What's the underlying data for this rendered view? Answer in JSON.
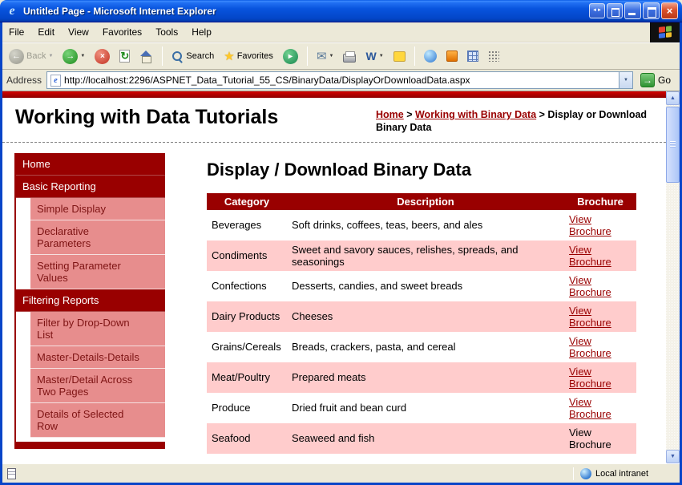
{
  "window": {
    "title": "Untitled Page - Microsoft Internet Explorer",
    "status_right": "Local intranet"
  },
  "menu": {
    "items": [
      "File",
      "Edit",
      "View",
      "Favorites",
      "Tools",
      "Help"
    ]
  },
  "toolbar": {
    "back_label": "Back",
    "search_label": "Search",
    "favorites_label": "Favorites",
    "go_label": "Go"
  },
  "address": {
    "label": "Address",
    "url": "http://localhost:2296/ASPNET_Data_Tutorial_55_CS/BinaryData/DisplayOrDownloadData.aspx"
  },
  "icons": {
    "ie_logo": "e",
    "back_arrow": "←",
    "forward_arrow": "→",
    "stop_x": "×",
    "media_play": "▸",
    "close_x": "×",
    "dropdown": "▼",
    "star": "★",
    "mail": "✉",
    "word_w": "W",
    "go_arrow": "→",
    "scroll_up": "▲",
    "scroll_down": "▼",
    "extra_arrows": "◄►"
  },
  "colors": {
    "accent_maroon": "#990000",
    "sidebar_item_pink": "#E78D8D",
    "table_alt_pink": "#FFCCCC",
    "link_maroon": "#990000",
    "titlebar_blue": "#0854DE"
  },
  "page": {
    "site_title": "Working with Data Tutorials",
    "breadcrumb_separator": ">",
    "breadcrumb": [
      {
        "label": "Home",
        "link": true
      },
      {
        "label": "Working with Binary Data",
        "link": true
      },
      {
        "label": "Display or Download Binary Data",
        "link": false
      }
    ],
    "heading": "Display / Download Binary Data",
    "sidebar": [
      {
        "label": "Home",
        "type": "header"
      },
      {
        "label": "Basic Reporting",
        "type": "header"
      },
      {
        "label": "Simple Display",
        "type": "item"
      },
      {
        "label": "Declarative Parameters",
        "type": "item"
      },
      {
        "label": "Setting Parameter Values",
        "type": "item"
      },
      {
        "label": "Filtering Reports",
        "type": "header"
      },
      {
        "label": "Filter by Drop-Down List",
        "type": "item"
      },
      {
        "label": "Master-Details-Details",
        "type": "item"
      },
      {
        "label": "Master/Detail Across Two Pages",
        "type": "item"
      },
      {
        "label": "Details of Selected Row",
        "type": "item"
      }
    ],
    "table": {
      "headers": [
        "Category",
        "Description",
        "Brochure"
      ],
      "rows": [
        {
          "category": "Beverages",
          "description": "Soft drinks, coffees, teas, beers, and ales",
          "brochure": "View Brochure",
          "brochure_link": true
        },
        {
          "category": "Condiments",
          "description": "Sweet and savory sauces, relishes, spreads, and seasonings",
          "brochure": "View Brochure",
          "brochure_link": true
        },
        {
          "category": "Confections",
          "description": "Desserts, candies, and sweet breads",
          "brochure": "View Brochure",
          "brochure_link": true
        },
        {
          "category": "Dairy Products",
          "description": "Cheeses",
          "brochure": "View Brochure",
          "brochure_link": true
        },
        {
          "category": "Grains/Cereals",
          "description": "Breads, crackers, pasta, and cereal",
          "brochure": "View Brochure",
          "brochure_link": true
        },
        {
          "category": "Meat/Poultry",
          "description": "Prepared meats",
          "brochure": "View Brochure",
          "brochure_link": true
        },
        {
          "category": "Produce",
          "description": "Dried fruit and bean curd",
          "brochure": "View Brochure",
          "brochure_link": true
        },
        {
          "category": "Seafood",
          "description": "Seaweed and fish",
          "brochure": "View Brochure",
          "brochure_link": false
        }
      ]
    }
  }
}
